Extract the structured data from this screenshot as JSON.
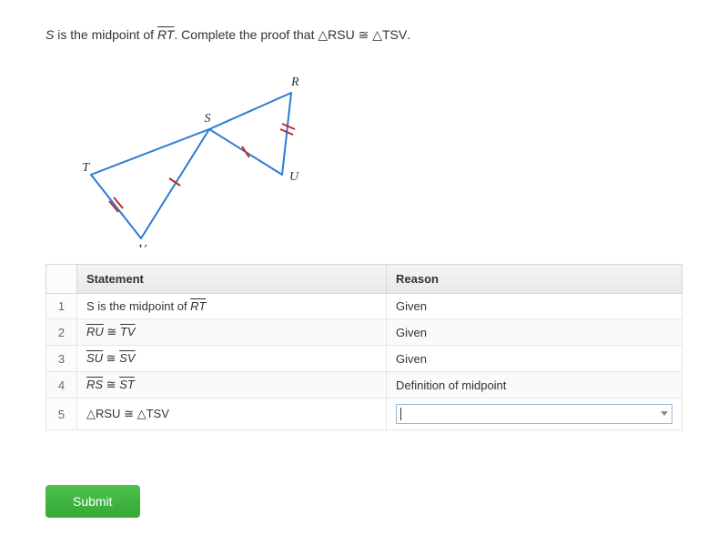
{
  "prompt": {
    "p1": "S",
    "p2": " is the midpoint of ",
    "seg": "RT",
    "p3": ". Complete the proof that ",
    "tri1": "△RSU",
    "cong": " ≅ ",
    "tri2": "△TSV",
    "p4": "."
  },
  "diagram": {
    "labels": {
      "R": "R",
      "S": "S",
      "T": "T",
      "U": "U",
      "V": "V"
    }
  },
  "table": {
    "head": {
      "num": "",
      "statement": "Statement",
      "reason": "Reason"
    },
    "rows": [
      {
        "n": "1",
        "stmt_pre": "S",
        "stmt_mid": " is the midpoint of ",
        "seg": "RT",
        "reason": "Given"
      },
      {
        "n": "2",
        "seg1": "RU",
        "cong": " ≅ ",
        "seg2": "TV",
        "reason": "Given"
      },
      {
        "n": "3",
        "seg1": "SU",
        "cong": " ≅ ",
        "seg2": "SV",
        "reason": "Given"
      },
      {
        "n": "4",
        "seg1": "RS",
        "cong": " ≅ ",
        "seg2": "ST",
        "reason": "Definition of midpoint"
      },
      {
        "n": "5",
        "tri1": "△RSU",
        "cong": " ≅ ",
        "tri2": "△TSV",
        "reason": ""
      }
    ]
  },
  "submit": "Submit"
}
